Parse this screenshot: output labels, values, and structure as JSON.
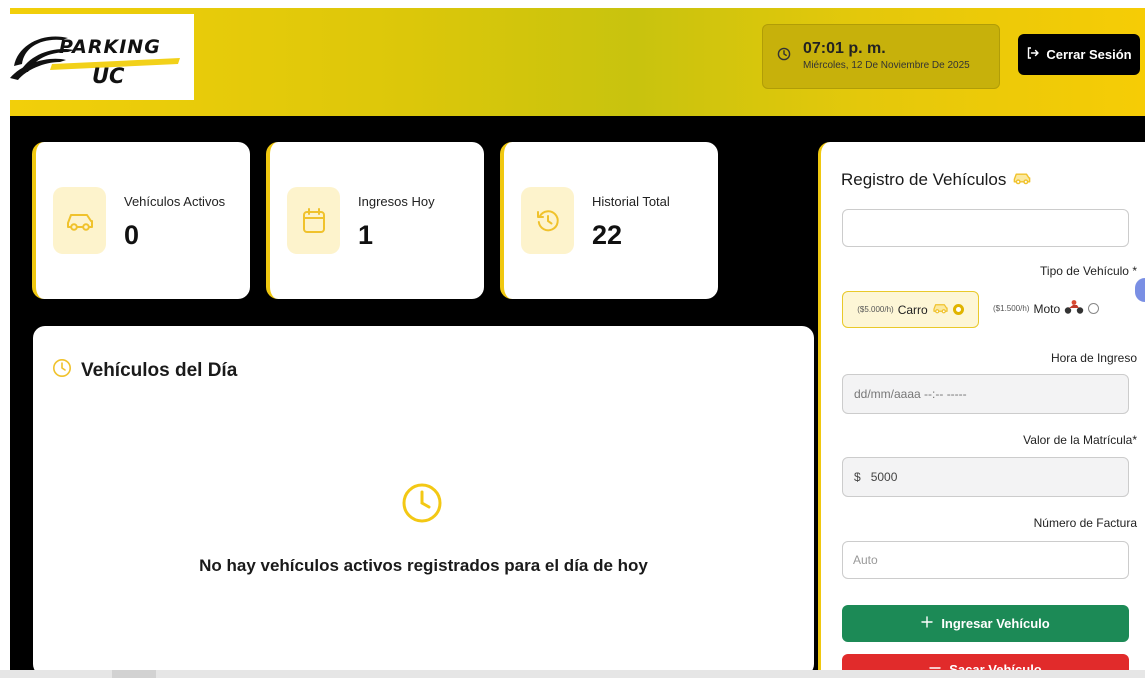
{
  "header": {
    "logo": {
      "line1": "PARKING",
      "line2": "UC"
    },
    "clock": {
      "time": "07:01 p. m.",
      "date": "Miércoles, 12 De Noviembre De 2025",
      "icon": "clock-icon"
    },
    "logout_label": "Cerrar Sesión",
    "logout_icon": "logout-icon"
  },
  "stats": [
    {
      "label": "Vehículos Activos",
      "value": "0",
      "icon": "car-icon"
    },
    {
      "label": "Ingresos Hoy",
      "value": "1",
      "icon": "calendar-icon"
    },
    {
      "label": "Historial Total",
      "value": "22",
      "icon": "history-icon"
    }
  ],
  "vehicles_today": {
    "title": "Vehículos del Día",
    "empty_message": "No hay vehículos activos registrados para el día de hoy"
  },
  "registro": {
    "title": "Registro de Vehículos",
    "plate_value": "",
    "tipo_label": "Tipo de Vehículo *",
    "options": [
      {
        "price": "($5.000/h)",
        "label": "Carro",
        "selected": true
      },
      {
        "price": "($1.500/h)",
        "label": "Moto",
        "selected": false
      }
    ],
    "hora_label": "Hora de Ingreso",
    "hora_placeholder": "dd/mm/aaaa --:-- -----",
    "matricula_label": "Valor de la Matrícula*",
    "matricula_prefix": "$",
    "matricula_value": "5000",
    "factura_label": "Número de Factura",
    "factura_placeholder": "Auto",
    "ingresar_label": "Ingresar Vehículo",
    "sacar_label": "Sacar Vehículo"
  },
  "colors": {
    "accent": "#f0c810",
    "dark": "#000000",
    "green": "#1c8a56",
    "red": "#e12b2b"
  }
}
